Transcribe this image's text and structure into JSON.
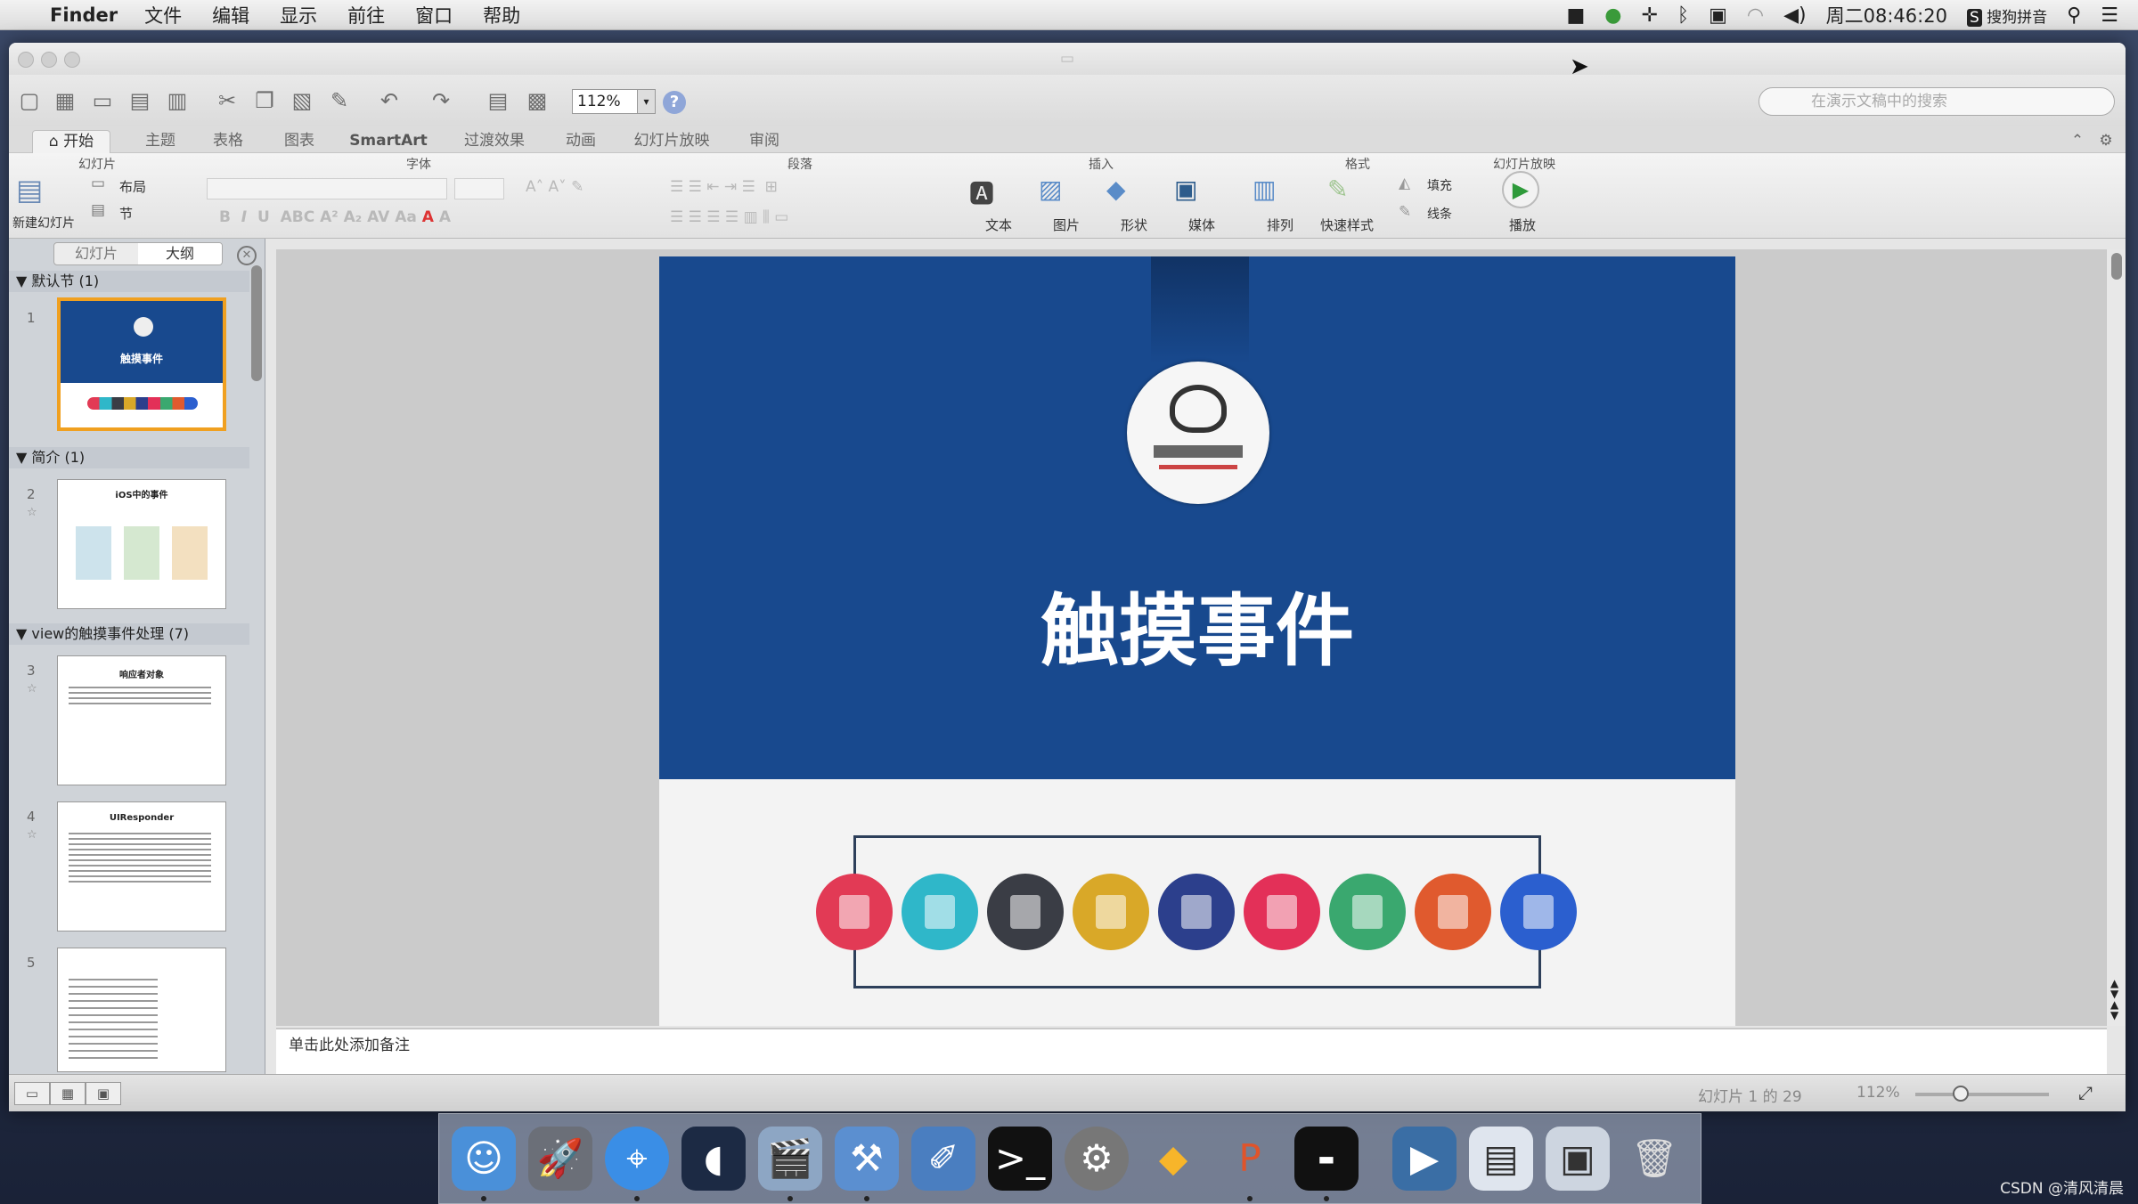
{
  "menubar": {
    "app": "Finder",
    "items": [
      "文件",
      "编辑",
      "显示",
      "前往",
      "窗口",
      "帮助"
    ],
    "clock": "周二08:46:20",
    "input_method": "搜狗拼音"
  },
  "toolbar": {
    "zoom": "112%",
    "search_placeholder": "在演示文稿中的搜索"
  },
  "ribbon": {
    "tabs": [
      "开始",
      "主题",
      "表格",
      "图表",
      "SmartArt",
      "过渡效果",
      "动画",
      "幻灯片放映",
      "审阅"
    ],
    "groups": {
      "slides": "幻灯片",
      "font": "字体",
      "paragraph": "段落",
      "insert": "插入",
      "format": "格式",
      "slideshow": "幻灯片放映"
    },
    "new_slide": "新建幻灯片",
    "layout": "布局",
    "section": "节",
    "insert_text": "文本",
    "insert_picture": "图片",
    "insert_shape": "形状",
    "insert_media": "媒体",
    "arrange": "排列",
    "quick_styles": "快速样式",
    "fill": "填充",
    "line": "线条",
    "play": "播放"
  },
  "left_pane": {
    "tab_slides": "幻灯片",
    "tab_outline": "大纲",
    "sections": [
      {
        "title": "默认节 (1)"
      },
      {
        "title": "简介 (1)"
      },
      {
        "title": "view的触摸事件处理 (7)"
      }
    ],
    "slide_numbers": [
      "1",
      "2",
      "3",
      "4",
      "5"
    ],
    "thumb_titles": {
      "t1": "触摸事件",
      "t2": "iOS中的事件",
      "t3": "响应者对象",
      "t4": "UIResponder"
    }
  },
  "slide": {
    "title": "触摸事件",
    "circle_colors": [
      "#e23a55",
      "#2fb7c9",
      "#3a3d45",
      "#d9a828",
      "#2c3f8c",
      "#e33058",
      "#3aa86f",
      "#e05a2e",
      "#2b5fcf"
    ]
  },
  "notes": {
    "placeholder": "单击此处添加备注"
  },
  "statusbar": {
    "slide_position": "幻灯片 1 的 29",
    "zoom": "112%"
  },
  "watermark": "CSDN @清风清晨"
}
